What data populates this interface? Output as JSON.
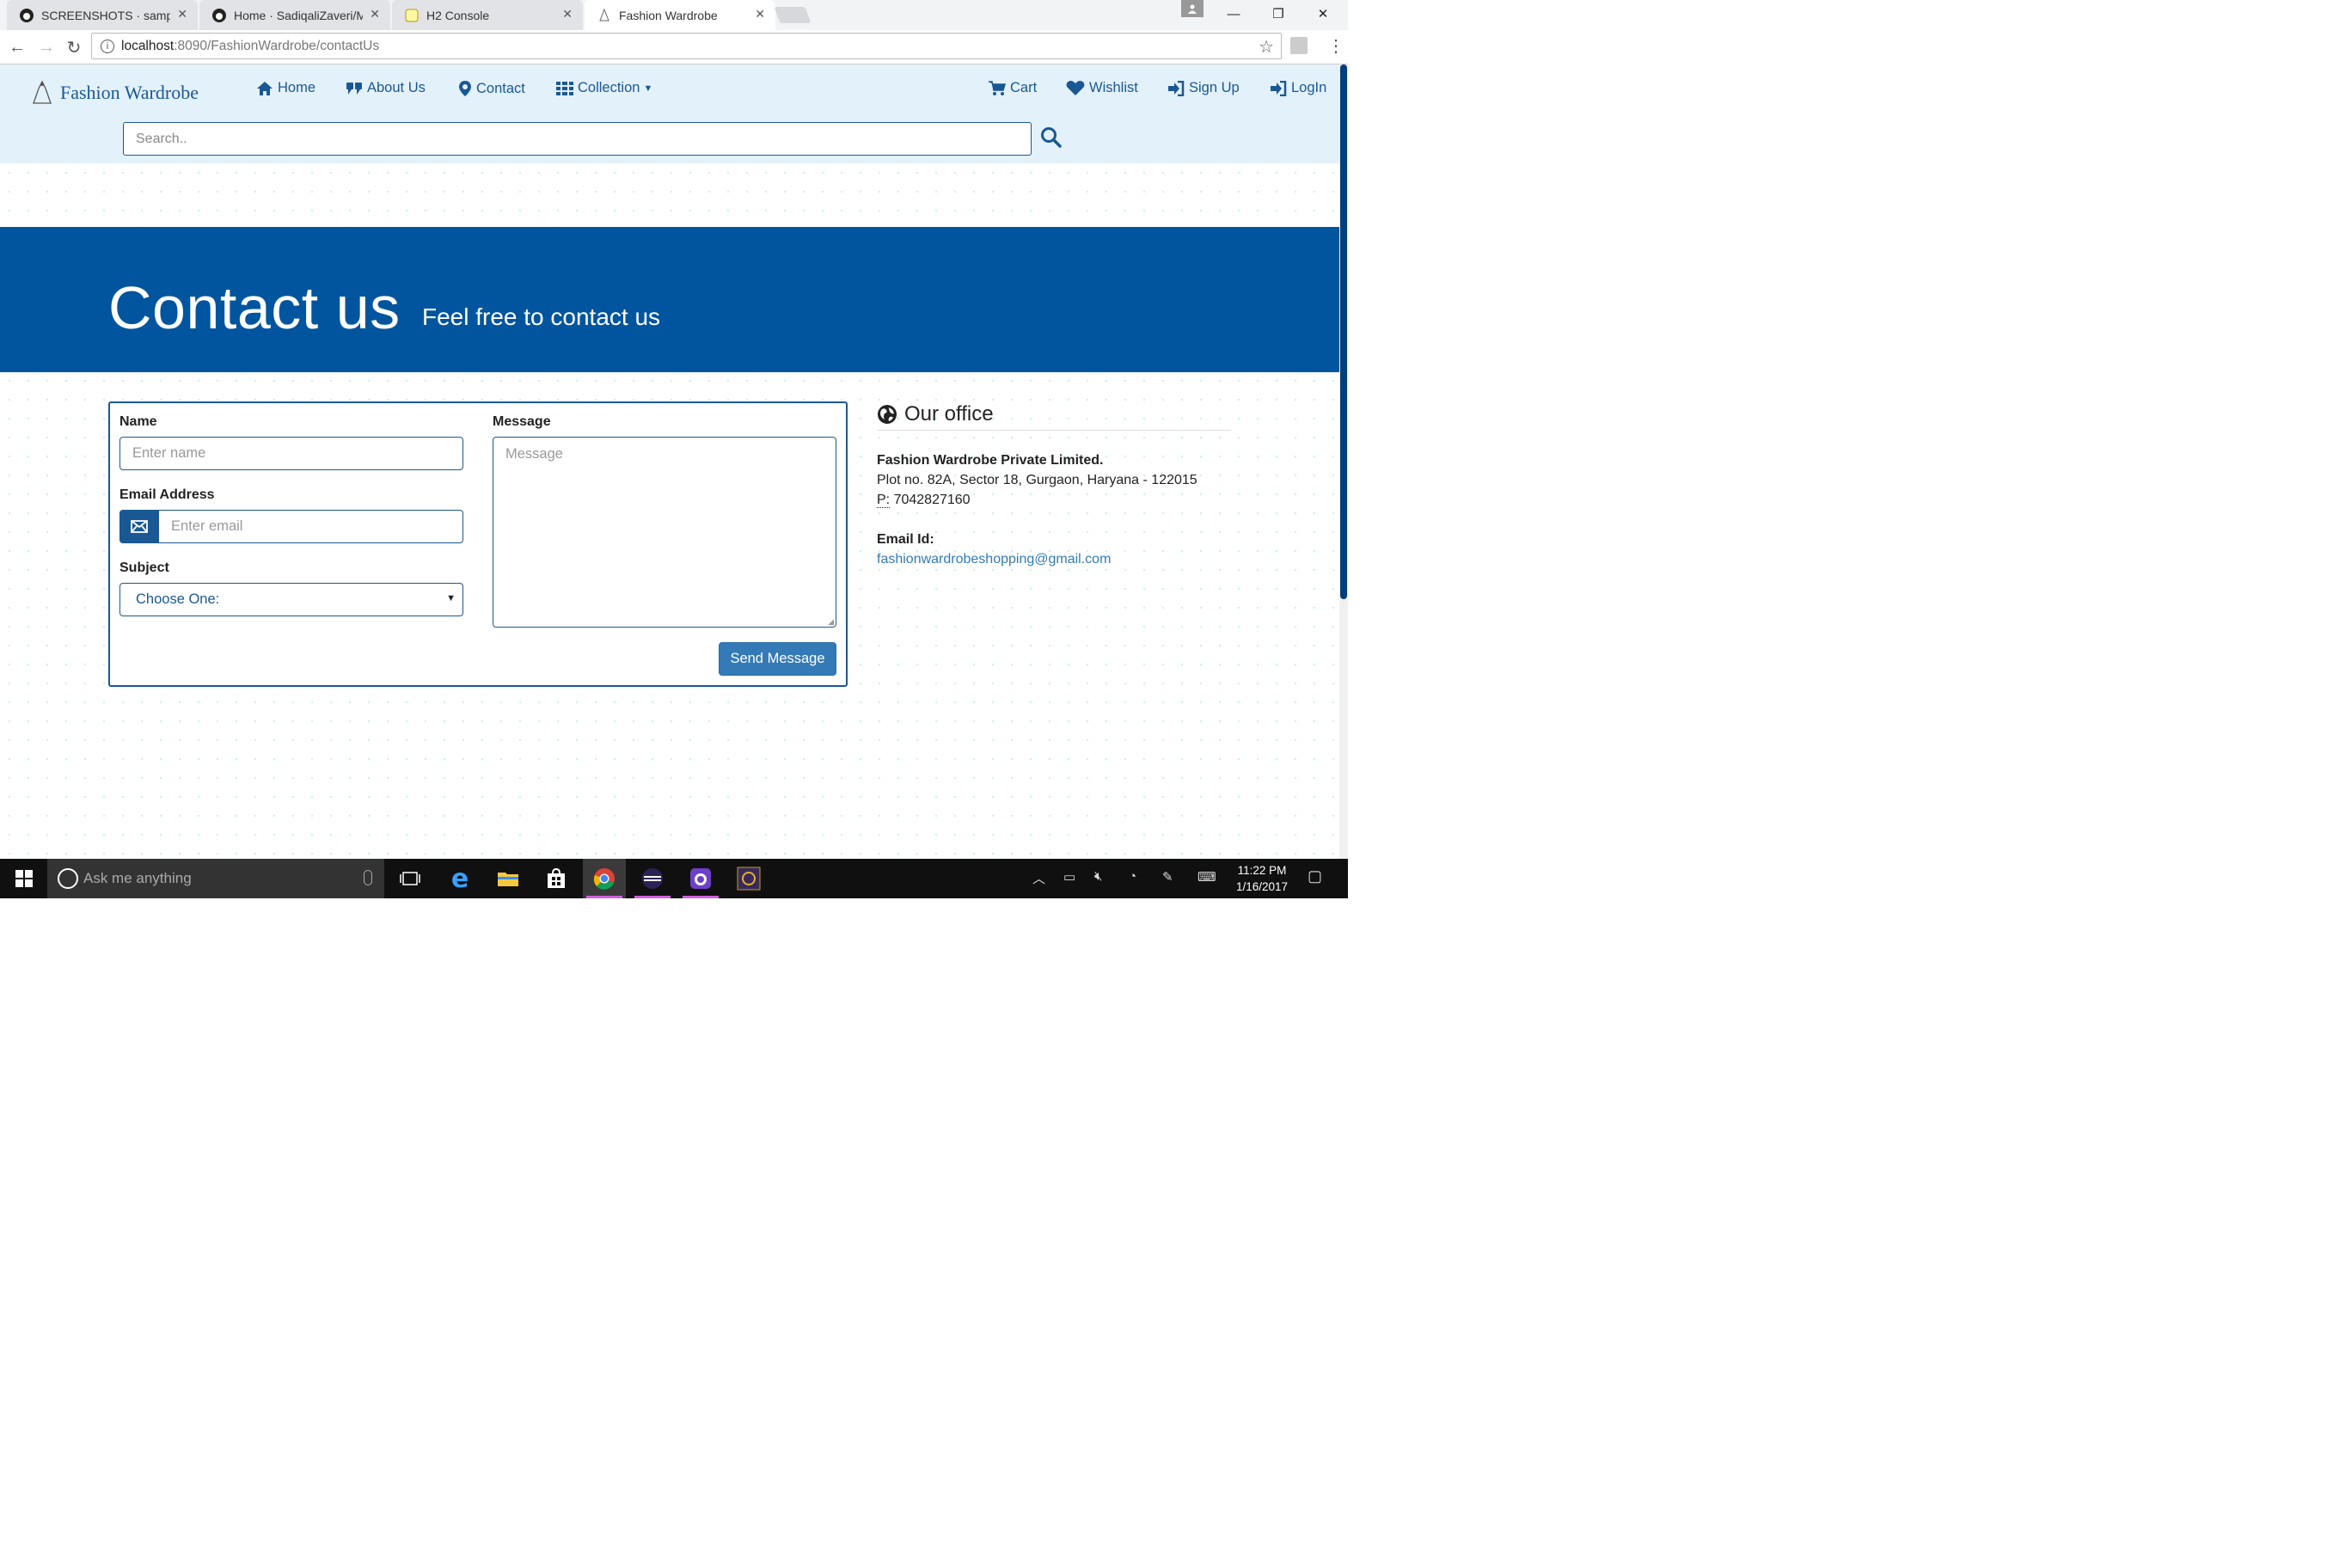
{
  "browser": {
    "tabs": [
      {
        "label": "SCREENSHOTS · sampda/",
        "icon": "github-icon",
        "active": false
      },
      {
        "label": "Home · SadiqaliZaveri/M",
        "icon": "github-icon",
        "active": false
      },
      {
        "label": "H2 Console",
        "icon": "h2-icon",
        "active": false
      },
      {
        "label": "Fashion Wardrobe",
        "icon": "site-logo-icon",
        "active": true
      }
    ],
    "url_host": "localhost",
    "url_path": ":8090/FashionWardrobe/contactUs"
  },
  "site": {
    "brand": "Fashion Wardrobe",
    "nav": {
      "home": "Home",
      "about": "About Us",
      "contact": "Contact",
      "collection": "Collection",
      "cart": "Cart",
      "wishlist": "Wishlist",
      "signup": "Sign Up",
      "login": "LogIn"
    },
    "search_placeholder": "Search.."
  },
  "hero": {
    "title": "Contact us",
    "subtitle": "Feel free to contact us"
  },
  "form": {
    "name_label": "Name",
    "name_placeholder": "Enter name",
    "email_label": "Email Address",
    "email_placeholder": "Enter email",
    "subject_label": "Subject",
    "subject_value": "Choose One:",
    "message_label": "Message",
    "message_placeholder": "Message",
    "send_label": "Send Message"
  },
  "office": {
    "title": "Our office",
    "company": "Fashion Wardrobe Private Limited.",
    "address": "Plot no. 82A, Sector 18, Gurgaon, Haryana - 122015",
    "phone_abbr": "P:",
    "phone": "7042827160",
    "email_label": "Email Id:",
    "email": "fashionwardrobeshopping@gmail.com"
  },
  "taskbar": {
    "search_placeholder": "Ask me anything",
    "time": "11:22 PM",
    "date": "1/16/2017"
  },
  "colors": {
    "brand_blue": "#1a5894",
    "hero_blue": "#00559e",
    "header_bg": "#e3f1fb",
    "button_blue": "#337ab7"
  }
}
